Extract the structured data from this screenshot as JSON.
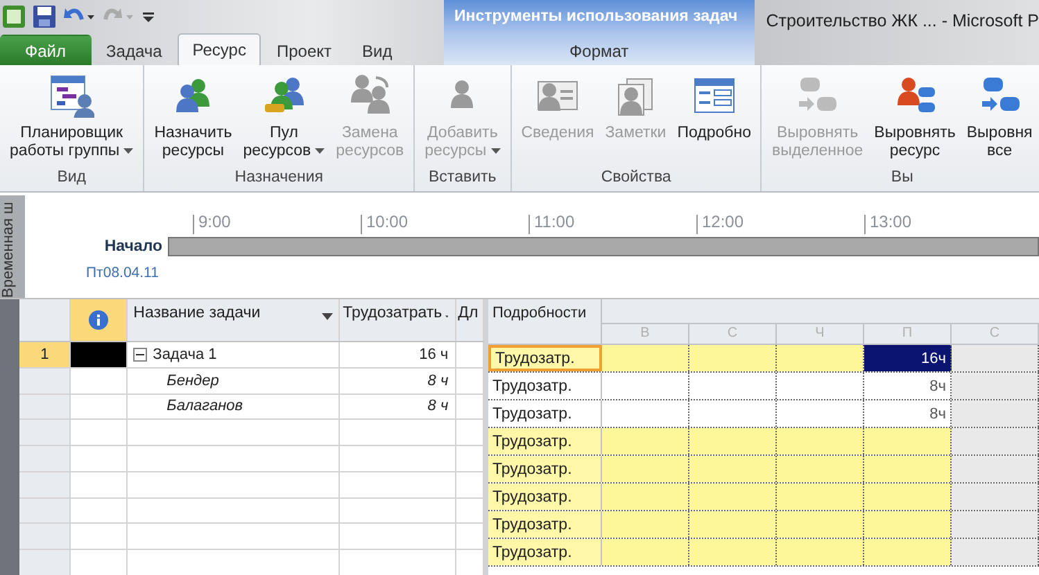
{
  "title_bar": {
    "title": "Строительство ЖК ...  -  Microsoft P",
    "contextual_group": "Инструменты использования задач"
  },
  "ribbon_tabs": [
    {
      "label": "Файл",
      "kind": "file",
      "selected": false
    },
    {
      "label": "Задача",
      "kind": "normal",
      "selected": false
    },
    {
      "label": "Ресурс",
      "kind": "normal",
      "selected": true
    },
    {
      "label": "Проект",
      "kind": "normal",
      "selected": false
    },
    {
      "label": "Вид",
      "kind": "normal",
      "selected": false
    },
    {
      "label": "Формат",
      "kind": "contextual",
      "selected": false
    }
  ],
  "ribbon_groups": [
    {
      "label": "Вид",
      "buttons": [
        {
          "lines": [
            "Планировщик",
            "работы группы"
          ],
          "disabled": false,
          "dropdown": true
        }
      ]
    },
    {
      "label": "Назначения",
      "buttons": [
        {
          "lines": [
            "Назначить",
            "ресурсы"
          ],
          "disabled": false,
          "dropdown": false
        },
        {
          "lines": [
            "Пул",
            "ресурсов"
          ],
          "disabled": false,
          "dropdown": true
        },
        {
          "lines": [
            "Замена",
            "ресурсов"
          ],
          "disabled": true,
          "dropdown": false
        }
      ]
    },
    {
      "label": "Вставить",
      "buttons": [
        {
          "lines": [
            "Добавить",
            "ресурсы"
          ],
          "disabled": true,
          "dropdown": true
        }
      ]
    },
    {
      "label": "Свойства",
      "buttons": [
        {
          "lines": [
            "Сведения"
          ],
          "disabled": true,
          "dropdown": false
        },
        {
          "lines": [
            "Заметки"
          ],
          "disabled": true,
          "dropdown": false
        },
        {
          "lines": [
            "Подробно"
          ],
          "disabled": false,
          "dropdown": false
        }
      ]
    },
    {
      "label": "Вы",
      "buttons": [
        {
          "lines": [
            "Выровнять",
            "выделенное"
          ],
          "disabled": true,
          "dropdown": false
        },
        {
          "lines": [
            "Выровнять",
            "ресурс"
          ],
          "disabled": false,
          "dropdown": false
        },
        {
          "lines": [
            "Выровня",
            "все"
          ],
          "disabled": false,
          "dropdown": false
        }
      ]
    }
  ],
  "timeline": {
    "side_label": "Временная ш",
    "ticks": [
      "9:00",
      "10:00",
      "11:00",
      "12:00",
      "13:00"
    ],
    "start_label": "Начало",
    "start_date": "Пт08.04.11"
  },
  "task_table": {
    "columns": [
      "Название задачи",
      "Трудозатрать",
      "Дл"
    ],
    "rows": [
      {
        "number": "1",
        "name": "Задача 1",
        "work": "16 ч",
        "kind": "task",
        "expanded": true,
        "selected": true
      },
      {
        "name": "Бендер",
        "work": "8 ч",
        "kind": "assignment",
        "selected": false
      },
      {
        "name": "Балаганов",
        "work": "8 ч",
        "kind": "assignment",
        "selected": false
      }
    ]
  },
  "usage_grid": {
    "details_header": "Подробности",
    "days": [
      {
        "label": "В",
        "weekend": false
      },
      {
        "label": "С",
        "weekend": false
      },
      {
        "label": "Ч",
        "weekend": false
      },
      {
        "label": "П",
        "weekend": false
      },
      {
        "label": "С",
        "weekend": true
      }
    ],
    "rows": [
      {
        "label": "Трудозатр.",
        "kind": "task",
        "selected": true,
        "cells": [
          {
            "selected": false
          },
          {
            "selected": false
          },
          {
            "selected": false
          },
          {
            "value": "16ч",
            "selected": true
          },
          {
            "selected": false
          }
        ]
      },
      {
        "label": "Трудозатр.",
        "kind": "assignment",
        "selected": false,
        "cells": [
          {
            "selected": false
          },
          {
            "selected": false
          },
          {
            "selected": false
          },
          {
            "value": "8ч",
            "selected": false
          },
          {
            "selected": false
          }
        ]
      },
      {
        "label": "Трудозатр.",
        "kind": "assignment",
        "selected": false,
        "cells": [
          {
            "selected": false
          },
          {
            "selected": false
          },
          {
            "selected": false
          },
          {
            "value": "8ч",
            "selected": false
          },
          {
            "selected": false
          }
        ]
      },
      {
        "label": "Трудозатр.",
        "kind": "empty",
        "selected": false,
        "cells": [
          {
            "selected": false
          },
          {
            "selected": false
          },
          {
            "selected": false
          },
          {
            "selected": false
          },
          {
            "selected": false
          }
        ]
      },
      {
        "label": "Трудозатр.",
        "kind": "empty",
        "selected": false,
        "cells": [
          {
            "selected": false
          },
          {
            "selected": false
          },
          {
            "selected": false
          },
          {
            "selected": false
          },
          {
            "selected": false
          }
        ]
      },
      {
        "label": "Трудозатр.",
        "kind": "empty",
        "selected": false,
        "cells": [
          {
            "selected": false
          },
          {
            "selected": false
          },
          {
            "selected": false
          },
          {
            "selected": false
          },
          {
            "selected": false
          }
        ]
      },
      {
        "label": "Трудозатр.",
        "kind": "empty",
        "selected": false,
        "cells": [
          {
            "selected": false
          },
          {
            "selected": false
          },
          {
            "selected": false
          },
          {
            "selected": false
          },
          {
            "selected": false
          }
        ]
      },
      {
        "label": "Трудозатр.",
        "kind": "empty",
        "selected": false,
        "cells": [
          {
            "selected": false
          },
          {
            "selected": false
          },
          {
            "selected": false
          },
          {
            "selected": false
          },
          {
            "selected": false
          }
        ]
      }
    ]
  }
}
